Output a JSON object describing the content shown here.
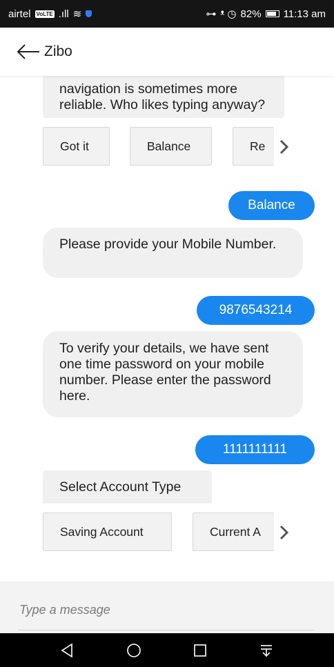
{
  "status_bar": {
    "carrier": "airtel",
    "volte": "VoLTE",
    "signal": ".ıll",
    "wifi": "≋",
    "key": "⊶",
    "alarm_icons": "ᵜ ◷",
    "battery_pct": "82%",
    "time": "11:13 am"
  },
  "header": {
    "title": "Zibo"
  },
  "messages": {
    "bot_0": "navigation is sometimes more reliable. Who likes typing anyway?",
    "user_1": "Balance",
    "bot_2": "Please provide your Mobile Number.",
    "user_3": "9876543214",
    "bot_4": "To verify your details, we have sent one time password on your mobile number. Please enter the password here.",
    "user_5": "1111111111",
    "bot_6": "Select Account Type"
  },
  "quick_replies_1": [
    "Got it",
    "Balance",
    "Re"
  ],
  "quick_replies_2": [
    "Saving Account",
    "Current A"
  ],
  "input": {
    "placeholder": "Type a message",
    "value": ""
  },
  "colors": {
    "user_bubble": "#1a87ef",
    "bot_bubble": "#f0f0f0",
    "status_bar": "#151515",
    "nav_bar": "#000000"
  },
  "icons": [
    "back-arrow-icon",
    "chevron-right-icon",
    "nav-back-icon",
    "nav-home-icon",
    "nav-recents-icon",
    "nav-notifications-icon"
  ]
}
